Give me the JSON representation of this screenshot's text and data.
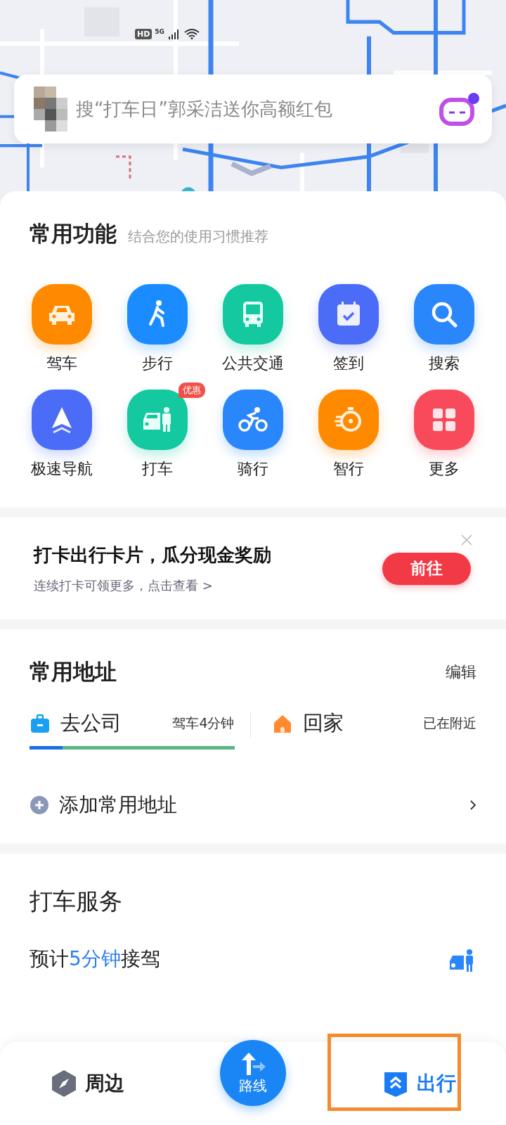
{
  "status_bar": {
    "hd": "HD",
    "network": "5G"
  },
  "search": {
    "placeholder": "搜“打车日”郭采洁送你高额红包",
    "assistant_alert": true
  },
  "common_functions": {
    "title": "常用功能",
    "subtitle": "结合您的使用习惯推荐",
    "items": [
      {
        "label": "驾车",
        "kind": "car",
        "color": "#ff8a00"
      },
      {
        "label": "步行",
        "kind": "walk",
        "color": "#1a8cff"
      },
      {
        "label": "公共交通",
        "kind": "bus",
        "color": "#14c8a0"
      },
      {
        "label": "签到",
        "kind": "calendar",
        "color": "#4a6cf7"
      },
      {
        "label": "搜索",
        "kind": "search",
        "color": "#2a86fb"
      },
      {
        "label": "极速导航",
        "kind": "navigate",
        "color": "#4a6cf7"
      },
      {
        "label": "打车",
        "kind": "taxi",
        "color": "#14c8a0",
        "badge": "优惠"
      },
      {
        "label": "骑行",
        "kind": "bike",
        "color": "#2a86fb"
      },
      {
        "label": "智行",
        "kind": "timer",
        "color": "#ff8a00"
      },
      {
        "label": "更多",
        "kind": "grid",
        "color": "#f84a5a"
      }
    ]
  },
  "promo": {
    "title": "打卡出行卡片，瓜分现金奖励",
    "subtitle": "连续打卡可领更多，点击查看 >",
    "button": "前往"
  },
  "addresses": {
    "title": "常用地址",
    "edit": "编辑",
    "items": [
      {
        "kind": "work",
        "label": "去公司",
        "info": "驾车4分钟",
        "level": 0.16
      },
      {
        "kind": "home",
        "label": "回家",
        "info": "已在附近"
      }
    ],
    "add": "添加常用地址"
  },
  "taxi_service": {
    "title": "打车服务",
    "eta_prefix": "预计",
    "eta_value": "5分钟",
    "eta_suffix": "接驾"
  },
  "bottom_nav": [
    {
      "kind": "nearby",
      "label": "周边",
      "selected": false
    },
    {
      "kind": "route",
      "label": "路线",
      "selected": false
    },
    {
      "kind": "travel",
      "label": "出行",
      "selected": true
    }
  ],
  "highlight_frame": true
}
